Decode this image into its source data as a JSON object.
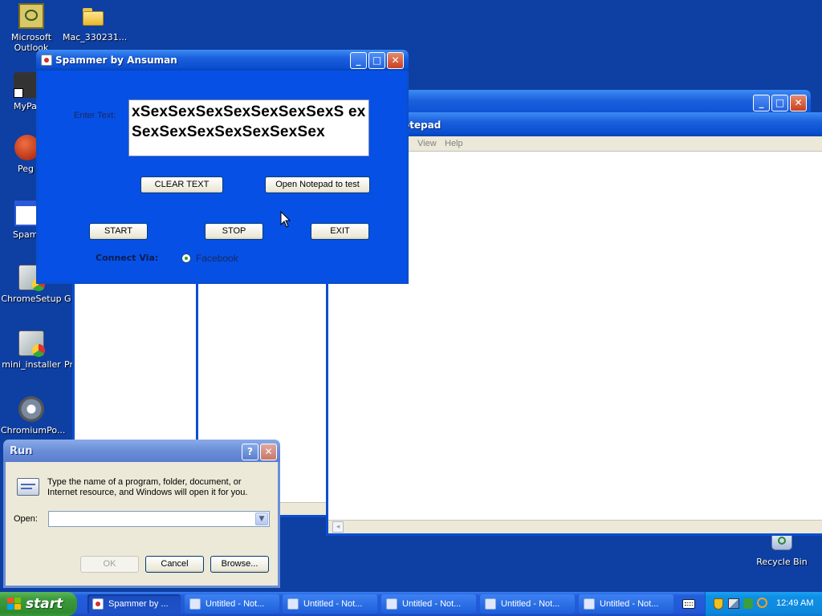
{
  "desktop": {
    "icons": [
      {
        "label": "Microsoft Outlook"
      },
      {
        "label": "Mac_330231..."
      },
      {
        "label": "MyPa"
      },
      {
        "label": "Peg"
      },
      {
        "label": "Spam"
      },
      {
        "label": "ChromeSetup"
      },
      {
        "label": "G"
      },
      {
        "label": "mini_installer"
      },
      {
        "label": "Pr"
      },
      {
        "label": "ChromiumPo..."
      },
      {
        "label": "Recycle Bin"
      }
    ]
  },
  "spammer": {
    "title": "Spammer by Ansuman",
    "enter_text_label": "Enter Text:",
    "text_value": "xSexSexSexSexSexSexSexS exSexSexSexSexSexSexSex",
    "clear_label": "CLEAR TEXT",
    "open_notepad_label": "Open Notepad to test",
    "start_label": "START",
    "stop_label": "STOP",
    "exit_label": "EXIT",
    "connect_label": "Connect Via:",
    "radio_label": "Facebook",
    "radio_selected": true
  },
  "notepad": {
    "title": "otepad",
    "menu": [
      "View",
      "Help"
    ]
  },
  "run": {
    "title": "Run",
    "description": "Type the name of a program, folder, document, or Internet resource, and Windows will open it for you.",
    "open_label": "Open:",
    "open_value": "",
    "ok_label": "OK",
    "cancel_label": "Cancel",
    "browse_label": "Browse..."
  },
  "taskbar": {
    "start_label": "start",
    "buttons": [
      {
        "label": "Spammer by ..."
      },
      {
        "label": "Untitled - Not..."
      },
      {
        "label": "Untitled - Not..."
      },
      {
        "label": "Untitled - Not..."
      },
      {
        "label": "Untitled - Not..."
      },
      {
        "label": "Untitled - Not..."
      }
    ],
    "clock": "12:49 AM"
  },
  "colors": {
    "desktop": "#0e3fa3",
    "spammer_body": "#0650e6",
    "titlebar": "#0a4fd0",
    "dialog_face": "#ece9d8",
    "taskbar": "#245edb",
    "tray": "#0f8fe6",
    "start": "#3c9a3c"
  }
}
